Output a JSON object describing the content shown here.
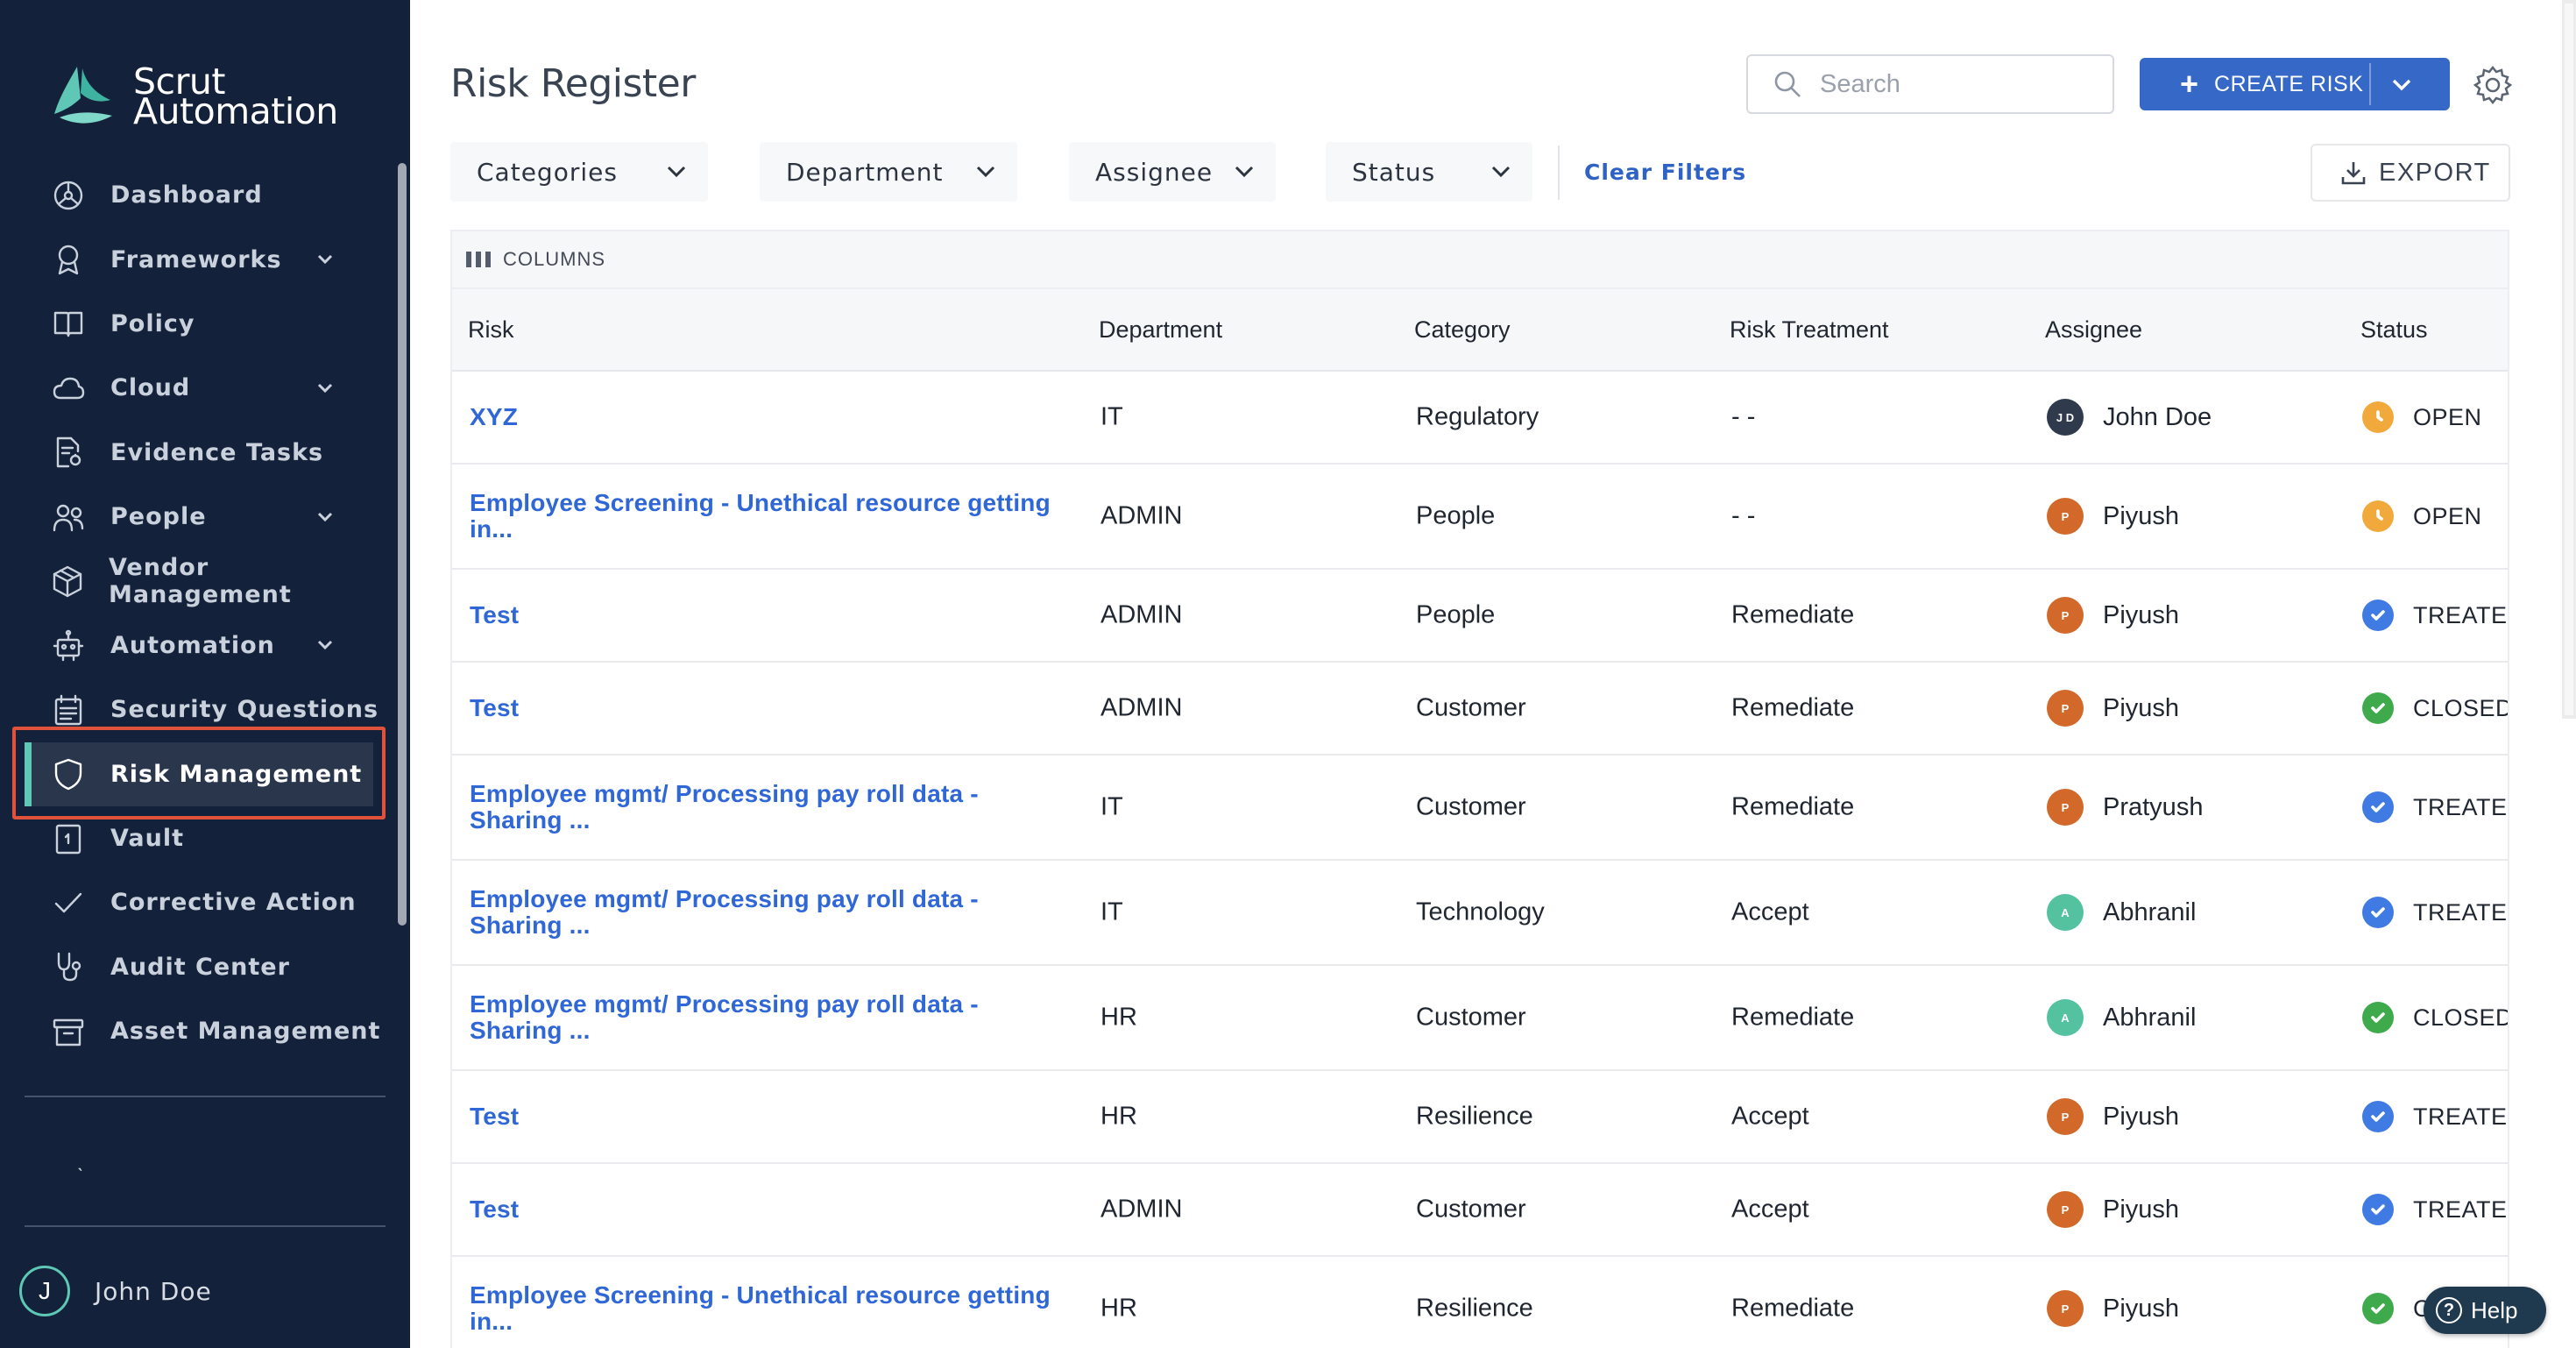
{
  "app": {
    "logo_line1": "Scrut",
    "logo_line2": "Automation"
  },
  "sidebar": {
    "items": [
      {
        "label": "Dashboard",
        "icon": "dashboard-icon",
        "has_chevron": false
      },
      {
        "label": "Frameworks",
        "icon": "award-icon",
        "has_chevron": true
      },
      {
        "label": "Policy",
        "icon": "book-icon",
        "has_chevron": false
      },
      {
        "label": "Cloud",
        "icon": "cloud-icon",
        "has_chevron": true
      },
      {
        "label": "Evidence Tasks",
        "icon": "evidence-icon",
        "has_chevron": false
      },
      {
        "label": "People",
        "icon": "people-icon",
        "has_chevron": true
      },
      {
        "label": "Vendor Management",
        "icon": "box-icon",
        "has_chevron": false
      },
      {
        "label": "Automation",
        "icon": "robot-icon",
        "has_chevron": true
      },
      {
        "label": "Security Questions",
        "icon": "calendar-icon",
        "has_chevron": false
      },
      {
        "label": "Risk Management",
        "icon": "shield-icon",
        "has_chevron": false,
        "active": true
      },
      {
        "label": "Vault",
        "icon": "vault-icon",
        "has_chevron": false
      },
      {
        "label": "Corrective Action",
        "icon": "check-icon",
        "has_chevron": false
      },
      {
        "label": "Audit Center",
        "icon": "stethoscope-icon",
        "has_chevron": false
      },
      {
        "label": "Asset Management",
        "icon": "archive-icon",
        "has_chevron": false
      }
    ],
    "dot": "ˎ",
    "user": {
      "initial": "J",
      "name": "John Doe"
    }
  },
  "header": {
    "title": "Risk Register",
    "search_placeholder": "Search",
    "create_label": "CREATE RISK",
    "create_plus": "+"
  },
  "filters": {
    "categories": "Categories",
    "department": "Department",
    "assignee": "Assignee",
    "status": "Status",
    "clear": "Clear Filters",
    "export": "EXPORT"
  },
  "table": {
    "columns_label": "COLUMNS",
    "headers": [
      "Risk",
      "Department",
      "Category",
      "Risk Treatment",
      "Assignee",
      "Status"
    ],
    "rows": [
      {
        "risk": "XYZ",
        "department": "IT",
        "category": "Regulatory",
        "treatment": "- -",
        "assignee": "John Doe",
        "initials": "J D",
        "avatar_color": "#2f3b4c",
        "status": "OPEN",
        "status_color": "#f2a93b",
        "status_kind": "open"
      },
      {
        "risk": "Employee Screening - Unethical resource getting in...",
        "department": "ADMIN",
        "category": "People",
        "treatment": "- -",
        "assignee": "Piyush",
        "initials": "P",
        "avatar_color": "#d2692a",
        "status": "OPEN",
        "status_color": "#f2a93b",
        "status_kind": "open"
      },
      {
        "risk": "Test",
        "department": "ADMIN",
        "category": "People",
        "treatment": "Remediate",
        "assignee": "Piyush",
        "initials": "P",
        "avatar_color": "#d2692a",
        "status": "TREATED",
        "status_color": "#3f7be3",
        "status_kind": "check"
      },
      {
        "risk": "Test",
        "department": "ADMIN",
        "category": "Customer",
        "treatment": "Remediate",
        "assignee": "Piyush",
        "initials": "P",
        "avatar_color": "#d2692a",
        "status": "CLOSED",
        "status_color": "#3faa4c",
        "status_kind": "check"
      },
      {
        "risk": "Employee mgmt/ Processing pay roll data - Sharing ...",
        "department": "IT",
        "category": "Customer",
        "treatment": "Remediate",
        "assignee": "Pratyush",
        "initials": "P",
        "avatar_color": "#d2692a",
        "status": "TREATED",
        "status_color": "#3f7be3",
        "status_kind": "check"
      },
      {
        "risk": "Employee mgmt/ Processing pay roll data - Sharing ...",
        "department": "IT",
        "category": "Technology",
        "treatment": "Accept",
        "assignee": "Abhranil",
        "initials": "A",
        "avatar_color": "#54c29e",
        "status": "TREATED",
        "status_color": "#3f7be3",
        "status_kind": "check"
      },
      {
        "risk": "Employee mgmt/ Processing pay roll data - Sharing ...",
        "department": "HR",
        "category": "Customer",
        "treatment": "Remediate",
        "assignee": "Abhranil",
        "initials": "A",
        "avatar_color": "#54c29e",
        "status": "CLOSED",
        "status_color": "#3faa4c",
        "status_kind": "check"
      },
      {
        "risk": "Test",
        "department": "HR",
        "category": "Resilience",
        "treatment": "Accept",
        "assignee": "Piyush",
        "initials": "P",
        "avatar_color": "#d2692a",
        "status": "TREATED",
        "status_color": "#3f7be3",
        "status_kind": "check"
      },
      {
        "risk": "Test",
        "department": "ADMIN",
        "category": "Customer",
        "treatment": "Accept",
        "assignee": "Piyush",
        "initials": "P",
        "avatar_color": "#d2692a",
        "status": "TREATED",
        "status_color": "#3f7be3",
        "status_kind": "check"
      },
      {
        "risk": "Employee Screening - Unethical resource getting in...",
        "department": "HR",
        "category": "Resilience",
        "treatment": "Remediate",
        "assignee": "Piyush",
        "initials": "P",
        "avatar_color": "#d2692a",
        "status": "C",
        "status_color": "#3faa4c",
        "status_kind": "check"
      }
    ]
  },
  "help": {
    "label": "Help",
    "q": "?"
  }
}
